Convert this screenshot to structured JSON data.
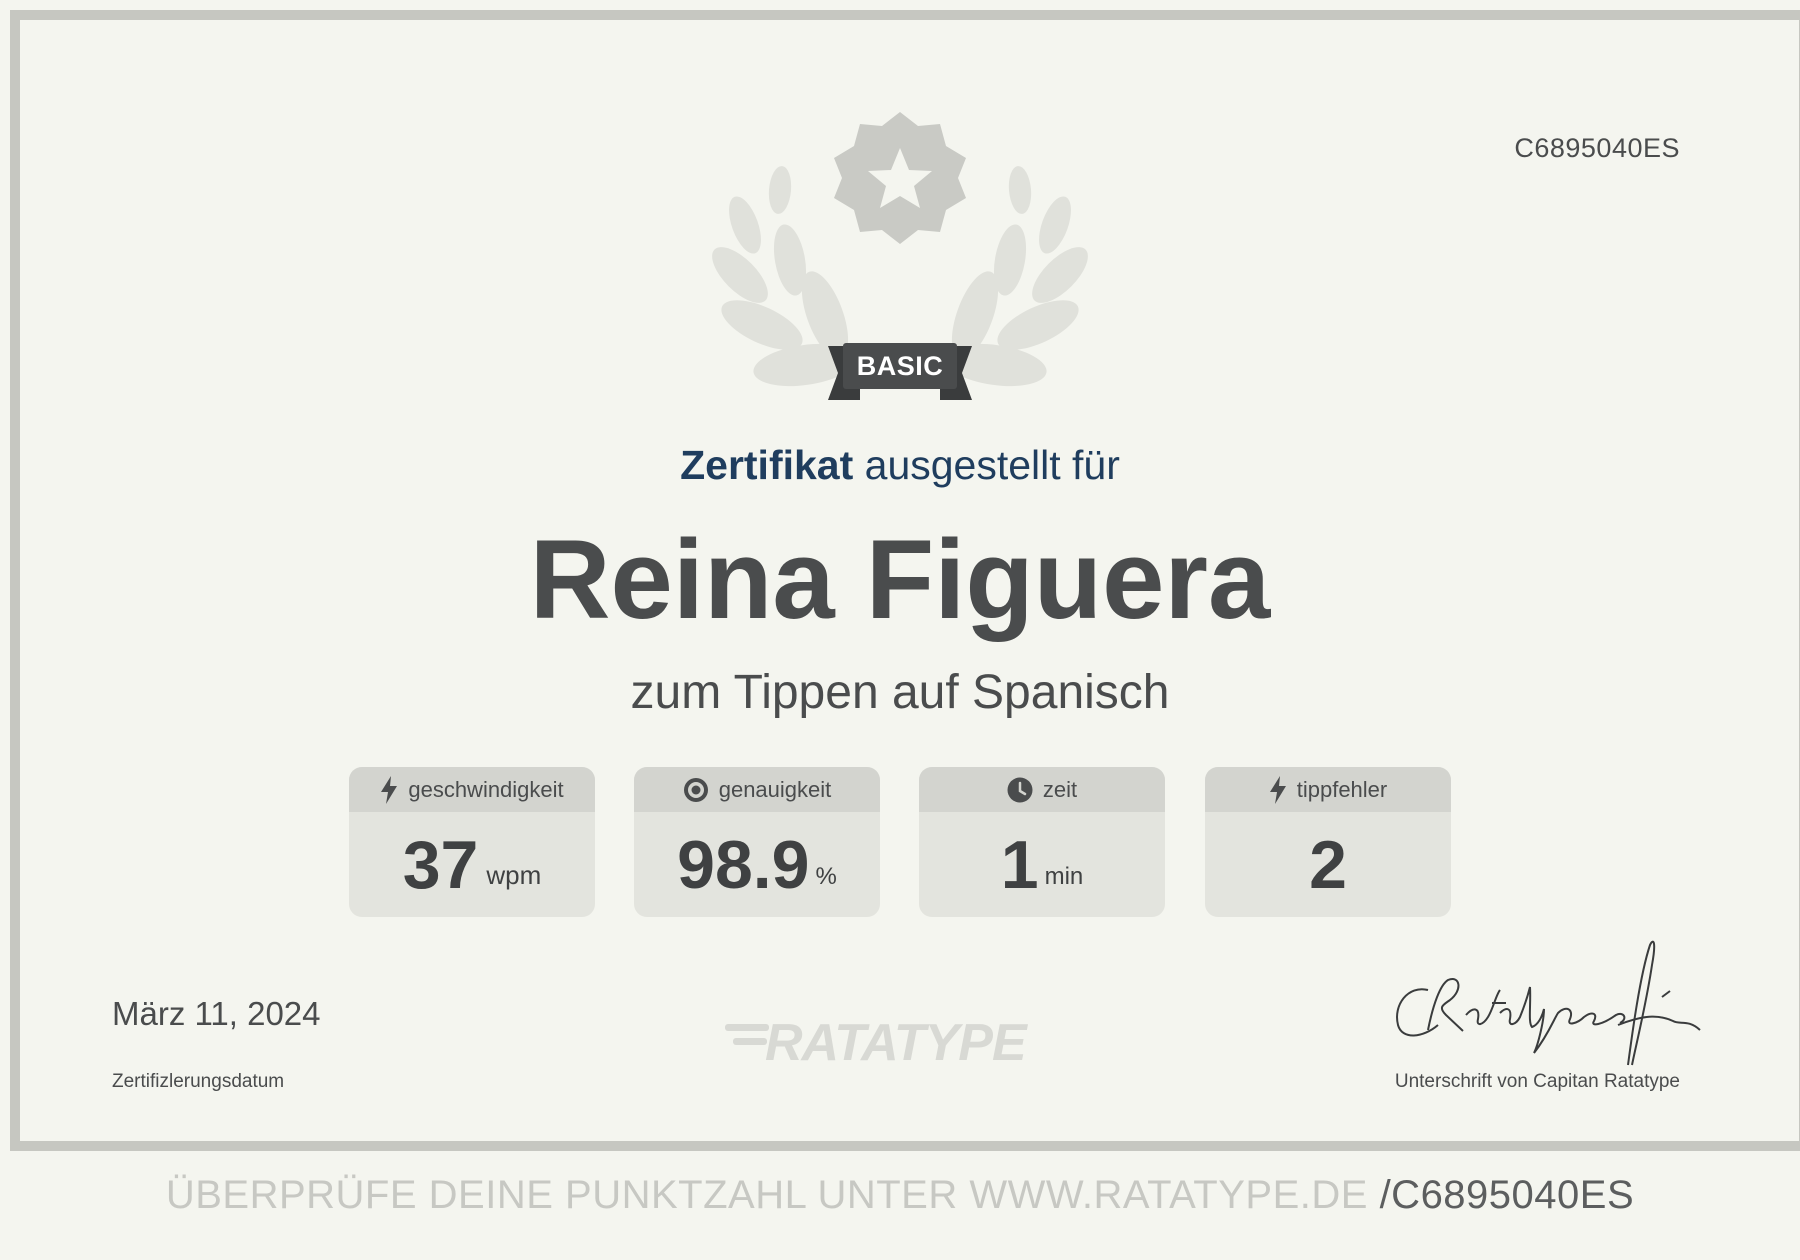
{
  "certificate": {
    "id": "C6895040ES",
    "level_badge": "BASIC",
    "heading_bold": "Zertifikat",
    "heading_rest": " ausgestellt für",
    "recipient_name": "Reina Figuera",
    "course": "zum Tippen auf Spanisch"
  },
  "stats": [
    {
      "label": "geschwindigkeit",
      "value": "37",
      "unit": "wpm",
      "icon": "lightning-icon"
    },
    {
      "label": "genauigkeit",
      "value": "98.9",
      "unit": "%",
      "icon": "target-icon"
    },
    {
      "label": "zeit",
      "value": "1",
      "unit": "min",
      "icon": "clock-icon"
    },
    {
      "label": "tippfehler",
      "value": "2",
      "unit": "",
      "icon": "lightning-icon"
    }
  ],
  "footer": {
    "date_value": "März 11, 2024",
    "date_label": "Zertifizlerungsdatum",
    "logo_text": "RATATYPE",
    "signature_label": "Unterschrift von Capitan Ratatype",
    "verify_lead": "ÜBERPRÜFE DEINE PUNKTZAHL UNTER WWW.RATATYPE.DE ",
    "verify_code": "/C6895040ES"
  },
  "colors": {
    "background": "#f4f5ef",
    "frame": "#c6c7c1",
    "heading_blue": "#1f3d5e",
    "text_dark": "#4a4c4d",
    "card_bg": "#e3e4de",
    "card_head": "#d3d4cf",
    "badge": "#4a4c4d"
  }
}
